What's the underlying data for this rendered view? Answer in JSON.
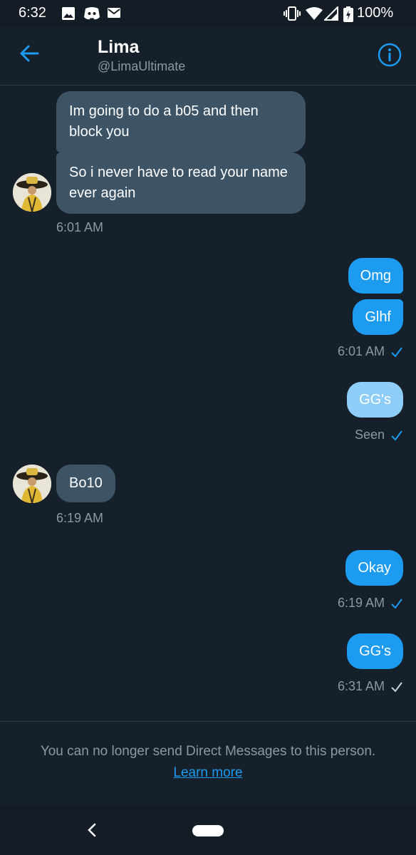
{
  "status_bar": {
    "time": "6:32",
    "battery": "100%",
    "icons": [
      "image-icon",
      "discord-icon",
      "mail-icon",
      "vibrate-icon",
      "wifi-icon",
      "signal-icon",
      "battery-icon"
    ]
  },
  "header": {
    "name": "Lima",
    "handle": "@LimaUltimate",
    "back_icon": "arrow-left-icon",
    "info_icon": "info-icon"
  },
  "messages": {
    "in1_text": "Im going to do a b05 and then block you",
    "in2_text": "So i never have to read your name ever again",
    "in_time1": "6:01 AM",
    "out1_text": "Omg",
    "out2_text": "Glhf",
    "out_time1": "6:01 AM",
    "out3_text": "GG's",
    "seen_label": "Seen",
    "in3_text": "Bo10",
    "in_time2": "6:19 AM",
    "out4_text": "Okay",
    "out_time2": "6:19 AM",
    "out5_text": "GG's",
    "out_time3": "6:31 AM"
  },
  "footer": {
    "notice": "You can no longer send Direct Messages to this person.",
    "link": "Learn more"
  },
  "colors": {
    "background": "#15202b",
    "accent": "#1d9bf0",
    "incoming_bubble": "#3d5466",
    "muted_text": "#8899a6"
  }
}
